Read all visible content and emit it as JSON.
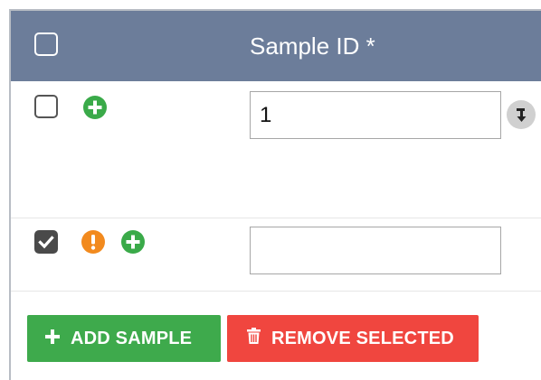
{
  "header": {
    "title": "Sample ID *",
    "select_all_checked": false
  },
  "rows": [
    {
      "checked": false,
      "sample_id": "1",
      "icons": [
        "plus-circle"
      ],
      "has_fill_down": true
    },
    {
      "checked": true,
      "sample_id": "",
      "icons": [
        "exclamation-circle",
        "plus-circle"
      ],
      "has_fill_down": false
    }
  ],
  "buttons": {
    "add_label": "ADD SAMPLE",
    "remove_label": "REMOVE SELECTED"
  },
  "colors": {
    "header_bg": "#6c7d9a",
    "add_green": "#3eaa4c",
    "remove_red": "#f0463f",
    "warning_orange": "#f28a1e"
  }
}
